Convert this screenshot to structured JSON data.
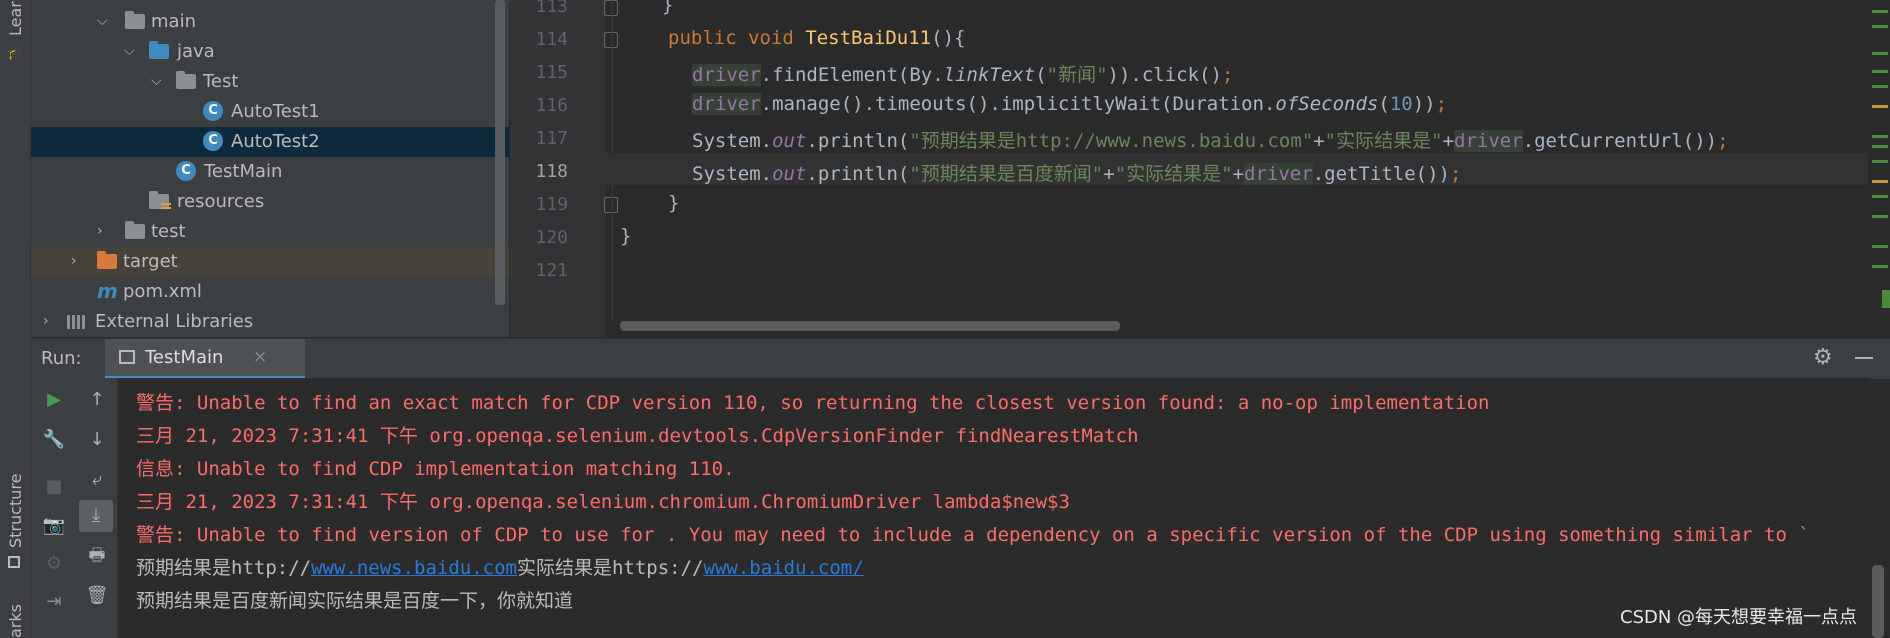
{
  "left_strip": {
    "learn_label": "Learn",
    "structure_label": "Structure",
    "bookmarks_label": "arks"
  },
  "project_tree": [
    {
      "label": "main",
      "kind": "folder"
    },
    {
      "label": "java",
      "kind": "folder-src"
    },
    {
      "label": "Test",
      "kind": "package"
    },
    {
      "label": "AutoTest1",
      "kind": "class"
    },
    {
      "label": "AutoTest2",
      "kind": "class",
      "selected": true
    },
    {
      "label": "TestMain",
      "kind": "class-main"
    },
    {
      "label": "resources",
      "kind": "folder-res"
    },
    {
      "label": "test",
      "kind": "folder"
    },
    {
      "label": "target",
      "kind": "folder-excluded"
    },
    {
      "label": "pom.xml",
      "kind": "maven"
    },
    {
      "label": "External Libraries",
      "kind": "libraries"
    }
  ],
  "editor": {
    "line_numbers": [
      "113",
      "114",
      "115",
      "116",
      "117",
      "118",
      "119",
      "120",
      "121"
    ],
    "current_line": "118",
    "method_name": "TestBaiDu11",
    "driver_var": "driver",
    "link_text": "\"新闻\"",
    "timeout_seconds": "10",
    "str_expected_url": "\"预期结果是http://www.news.baidu.com\"",
    "str_actual": "\"实际结果是\"",
    "str_expected_title": "\"预期结果是百度新闻\""
  },
  "run": {
    "label": "Run:",
    "tab": "TestMain",
    "console": [
      {
        "type": "err",
        "text": "警告: Unable to find an exact match for CDP version 110, so returning the closest version found: a no-op implementation"
      },
      {
        "type": "err",
        "text": "三月 21, 2023 7:31:41 下午 org.openqa.selenium.devtools.CdpVersionFinder findNearestMatch"
      },
      {
        "type": "err",
        "text": "信息: Unable to find CDP implementation matching 110."
      },
      {
        "type": "err",
        "text": "三月 21, 2023 7:31:41 下午 org.openqa.selenium.chromium.ChromiumDriver lambda$new$3"
      },
      {
        "type": "err",
        "text": "警告: Unable to find version of CDP to use for . You may need to include a dependency on a specific version of the CDP using something similar to `"
      }
    ],
    "out_line1": {
      "prefix": "预期结果是http://",
      "link1": "www.news.baidu.com",
      "middle": "实际结果是https://",
      "link2": "www.baidu.com/"
    },
    "out_line2": "预期结果是百度新闻实际结果是百度一下，你就知道"
  },
  "watermark": "CSDN @每天想要幸福一点点",
  "colors": {
    "keyword": "#cc7832",
    "string": "#6a8759",
    "error": "#ff6b68",
    "link": "#287bde"
  }
}
